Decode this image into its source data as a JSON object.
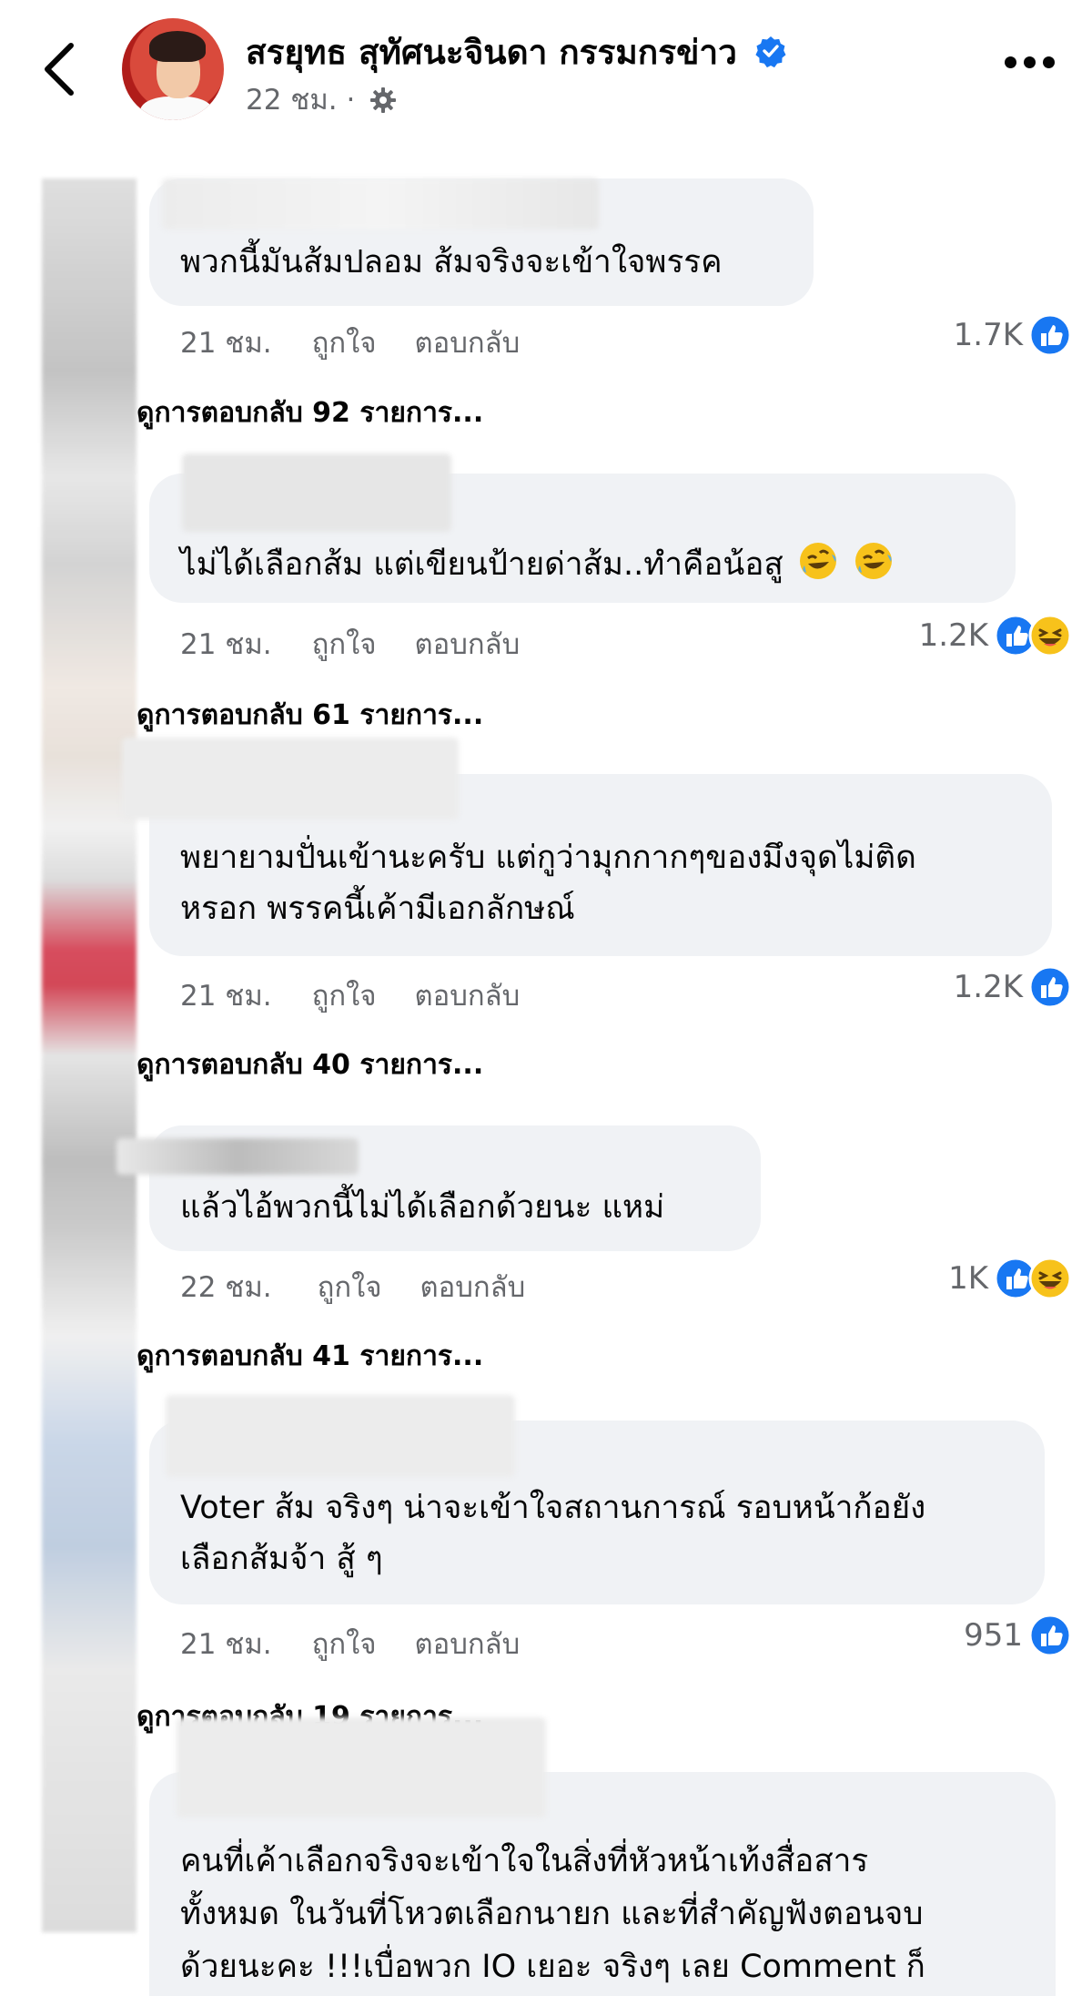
{
  "header": {
    "author_name": "สรยุทธ สุทัศนะจินดา กรรมกรข่าว",
    "post_time": "22 ชม. ·"
  },
  "actions": {
    "like_label": "ถูกใจ",
    "reply_label": "ตอบกลับ"
  },
  "comments": [
    {
      "text_lines": [
        "พวกนี้มันส้มปลอม ส้มจริงจะเข้าใจพรรค"
      ],
      "time": "21 ชม.",
      "reaction_count": "1.7K",
      "reactions": [
        "like-icon"
      ],
      "view_replies": "ดูการตอบกลับ 92 รายการ..."
    },
    {
      "text_lines": [
        "ไม่ได้เลือกส้ม แต่เขียนป้ายด่าส้ม..ทำคือน้อสู"
      ],
      "time": "21 ชม.",
      "reaction_count": "1.2K",
      "reactions": [
        "like-icon",
        "haha-icon"
      ],
      "view_replies": "ดูการตอบกลับ 61 รายการ..."
    },
    {
      "text_lines": [
        "พยายามปั่นเข้านะครับ แต่กูว่ามุกกากๆของมึงจุดไม่ติด",
        "หรอก พรรคนี้เค้ามีเอกลักษณ์"
      ],
      "time": "21 ชม.",
      "reaction_count": "1.2K",
      "reactions": [
        "like-icon"
      ],
      "view_replies": "ดูการตอบกลับ 40 รายการ..."
    },
    {
      "text_lines": [
        "แล้วไอ้พวกนี้ไม่ได้เลือกด้วยนะ แหม่"
      ],
      "time": "22 ชม.",
      "reaction_count": "1K",
      "reactions": [
        "like-icon",
        "haha-icon"
      ],
      "view_replies": "ดูการตอบกลับ 41 รายการ..."
    },
    {
      "text_lines": [
        "Voter ส้ม จริงๆ น่าจะเข้าใจสถานการณ์ รอบหน้าก้อยัง",
        "เลือกส้มจ้า สู้ ๆ"
      ],
      "time": "21 ชม.",
      "reaction_count": "951",
      "reactions": [
        "like-icon"
      ],
      "view_replies": "ดูการตอบกลับ 19 รายการ..."
    },
    {
      "text_lines": [
        "คนที่เค้าเลือกจริงจะเข้าใจในสิ่งที่หัวหน้าเท้งสื่อสาร",
        "ทั้งหมด ในวันที่โหวตเลือกนายก และที่สำคัญฟังตอนจบ",
        "ด้วยนะคะ !!!เบื่อพวก IO เยอะ จริงๆ เลย Comment ก็"
      ]
    }
  ],
  "colors": {
    "facebook_blue": "#1877f2",
    "bubble_bg": "#f0f2f5",
    "secondary_text": "#65676b"
  }
}
